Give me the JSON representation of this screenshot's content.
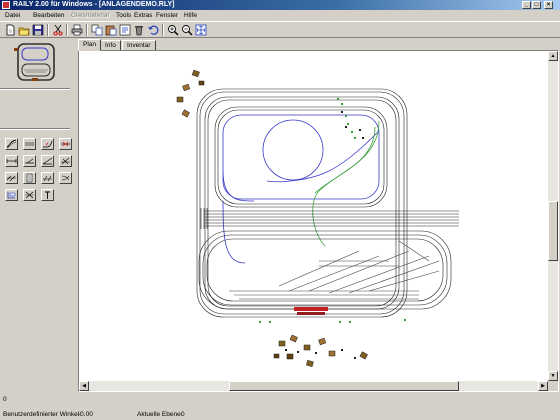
{
  "window": {
    "title": "RAILY 2.00 für Windows - [ANLAGENDEMO.RLY]",
    "minimize": "_",
    "maximize": "□",
    "close": "×"
  },
  "menu": [
    {
      "label": "Datei",
      "enabled": true
    },
    {
      "label": "Bearbeiten",
      "enabled": true
    },
    {
      "label": "Gleismaterial",
      "enabled": false
    },
    {
      "label": "Tools",
      "enabled": true
    },
    {
      "label": "Extras",
      "enabled": true
    },
    {
      "label": "Fenster",
      "enabled": true
    },
    {
      "label": "Hilfe",
      "enabled": true
    }
  ],
  "toolbar_icons": [
    "new-icon",
    "open-icon",
    "save-icon",
    "cut-icon",
    "print-icon",
    "copy-icon",
    "paste-icon",
    "properties-icon",
    "delete-icon",
    "undo-icon",
    "zoom-in-icon",
    "zoom-out-icon",
    "zoom-fit-icon"
  ],
  "track_tools": [
    "flex-track-icon",
    "straight-track-icon",
    "curve-track-icon",
    "switch-track-icon",
    "turnout-left-icon",
    "turnout-right-icon",
    "crossing-icon",
    "double-slip-icon",
    "buffer-icon",
    "turntable-icon",
    "bridge-icon",
    "signal-icon",
    "object-icon",
    "x-crossing-icon",
    "text-icon"
  ],
  "tabs": [
    "Plan",
    "Info",
    "Inventar"
  ],
  "active_tab": 0,
  "status": {
    "field1": "0",
    "angle_label": "Benutzerdefinierter Winkel:",
    "angle_value": "-0.00",
    "level_label": "Aktuelle Ebene:",
    "level_value": "0"
  },
  "colors": {
    "track": "#202020",
    "track_blue": "#3a3ac8",
    "track_green": "#3aa03a",
    "track_red": "#c02020",
    "title_active": "#0a246a"
  }
}
